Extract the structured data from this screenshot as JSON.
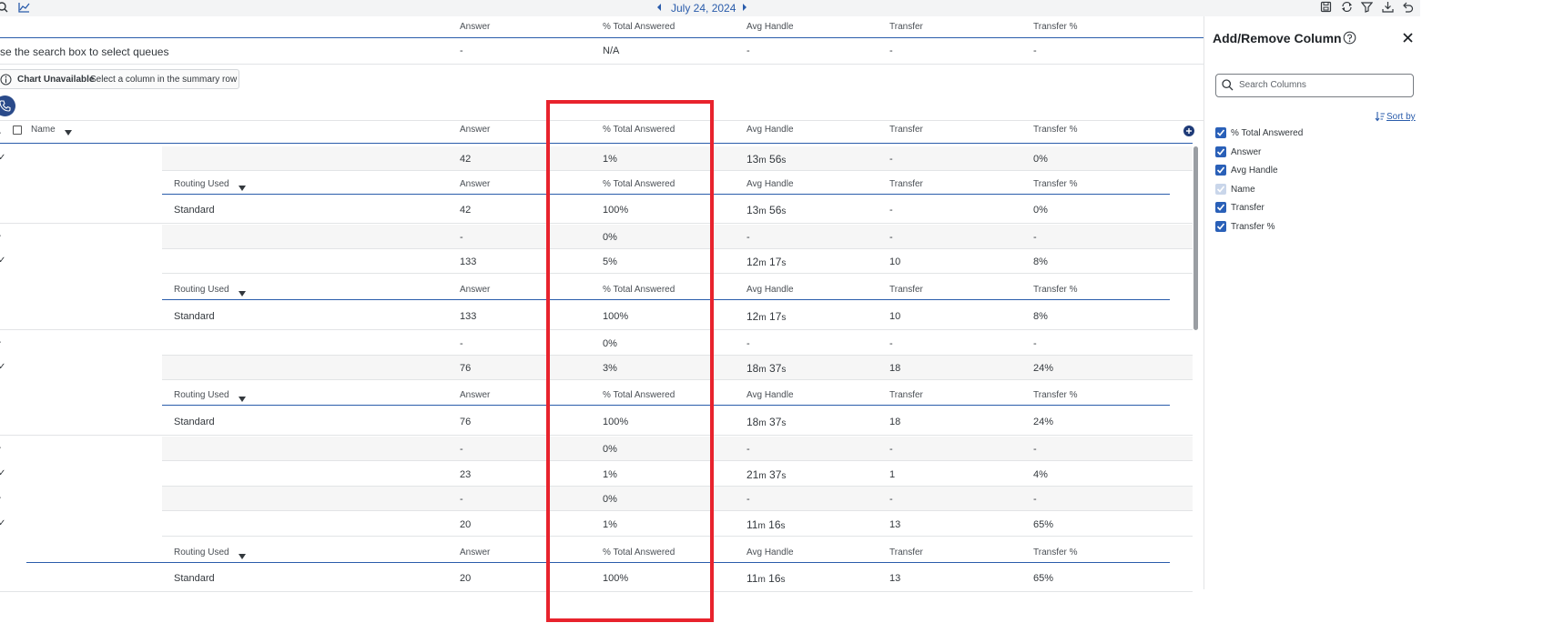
{
  "toolbar": {
    "date": "July 24, 2024"
  },
  "summary": {
    "headers": [
      "Answer",
      "% Total Answered",
      "Avg Handle",
      "Transfer",
      "Transfer %"
    ],
    "queue_hint": "se the search box to select queues",
    "values": [
      "-",
      "N/A",
      "-",
      "-",
      "-"
    ]
  },
  "chart_notice": {
    "title": "Chart Unavailable",
    "text": "Select a column in the summary row"
  },
  "table": {
    "name_header": "Name",
    "headers": [
      "Answer",
      "% Total Answered",
      "Avg Handle",
      "Transfer",
      "Transfer %"
    ],
    "sub_header_label": "Routing Used",
    "rows": [
      {
        "kind": "main",
        "shaded": true,
        "answer": "42",
        "pct": "1%",
        "handle": {
          "m": "13",
          "s": "56"
        },
        "transfer": "-",
        "tpct": "0%"
      },
      {
        "kind": "subheader"
      },
      {
        "kind": "sub",
        "label": "Standard",
        "answer": "42",
        "pct": "100%",
        "handle": {
          "m": "13",
          "s": "56"
        },
        "transfer": "-",
        "tpct": "0%"
      },
      {
        "kind": "main",
        "shaded": true,
        "answer": "-",
        "pct": "0%",
        "handle": null,
        "transfer": "-",
        "tpct": "-"
      },
      {
        "kind": "main",
        "shaded": false,
        "answer": "133",
        "pct": "5%",
        "handle": {
          "m": "12",
          "s": "17"
        },
        "transfer": "10",
        "tpct": "8%"
      },
      {
        "kind": "subheader"
      },
      {
        "kind": "sub",
        "label": "Standard",
        "answer": "133",
        "pct": "100%",
        "handle": {
          "m": "12",
          "s": "17"
        },
        "transfer": "10",
        "tpct": "8%"
      },
      {
        "kind": "main",
        "shaded": false,
        "answer": "-",
        "pct": "0%",
        "handle": null,
        "transfer": "-",
        "tpct": "-"
      },
      {
        "kind": "main",
        "shaded": true,
        "answer": "76",
        "pct": "3%",
        "handle": {
          "m": "18",
          "s": "37"
        },
        "transfer": "18",
        "tpct": "24%"
      },
      {
        "kind": "subheader"
      },
      {
        "kind": "sub",
        "label": "Standard",
        "answer": "76",
        "pct": "100%",
        "handle": {
          "m": "18",
          "s": "37"
        },
        "transfer": "18",
        "tpct": "24%"
      },
      {
        "kind": "main",
        "shaded": true,
        "answer": "-",
        "pct": "0%",
        "handle": null,
        "transfer": "-",
        "tpct": "-"
      },
      {
        "kind": "main",
        "shaded": false,
        "answer": "23",
        "pct": "1%",
        "handle": {
          "m": "21",
          "s": "37"
        },
        "transfer": "1",
        "tpct": "4%"
      },
      {
        "kind": "main",
        "shaded": true,
        "answer": "-",
        "pct": "0%",
        "handle": null,
        "transfer": "-",
        "tpct": "-"
      },
      {
        "kind": "main",
        "shaded": false,
        "answer": "20",
        "pct": "1%",
        "handle": {
          "m": "11",
          "s": "16"
        },
        "transfer": "13",
        "tpct": "65%"
      },
      {
        "kind": "subheader"
      },
      {
        "kind": "sub",
        "label": "Standard",
        "answer": "20",
        "pct": "100%",
        "handle": {
          "m": "11",
          "s": "16"
        },
        "transfer": "13",
        "tpct": "65%"
      }
    ],
    "units": {
      "m": "m",
      "s": "s"
    }
  },
  "panel": {
    "title": "Add/Remove Column",
    "search_placeholder": "Search Columns",
    "sort_label": "Sort by",
    "columns": [
      {
        "label": "% Total Answered",
        "checked": true,
        "disabled": false
      },
      {
        "label": "Answer",
        "checked": true,
        "disabled": false
      },
      {
        "label": "Avg Handle",
        "checked": true,
        "disabled": false
      },
      {
        "label": "Name",
        "checked": true,
        "disabled": true
      },
      {
        "label": "Transfer",
        "checked": true,
        "disabled": false
      },
      {
        "label": "Transfer %",
        "checked": true,
        "disabled": false
      }
    ]
  },
  "colors": {
    "accent": "#2a5cab",
    "highlight": "#e8232d"
  }
}
